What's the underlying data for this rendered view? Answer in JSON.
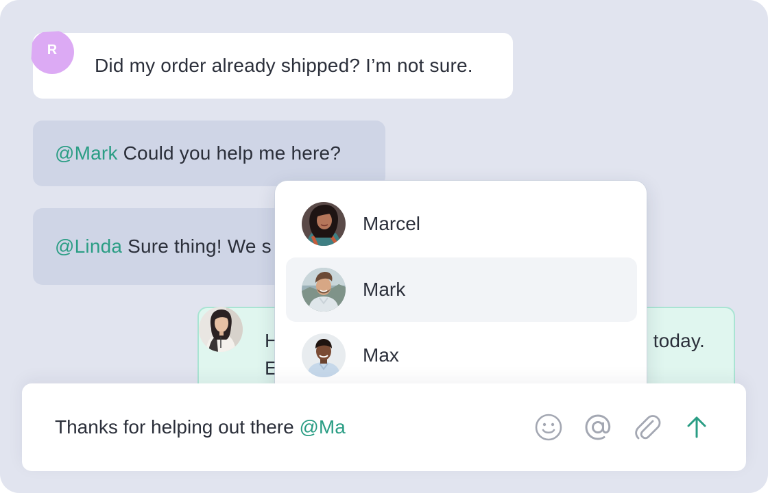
{
  "messages": {
    "customer": {
      "avatar_initial": "R",
      "text": "Did my order already shipped? I’m not sure."
    },
    "agent_reply_1": {
      "mention": "@Mark",
      "text": " Could you help me here?"
    },
    "agent_reply_2": {
      "mention": "@Linda",
      "text": " Sure thing! We s"
    },
    "linda_message": {
      "line1_start": "H",
      "line1_end": "today.",
      "line2_start": "E"
    }
  },
  "mention_dropdown": {
    "items": [
      {
        "name": "Marcel",
        "highlighted": false
      },
      {
        "name": "Mark",
        "highlighted": true
      },
      {
        "name": "Max",
        "highlighted": false
      }
    ]
  },
  "composer": {
    "text": "Thanks for helping out there ",
    "mention_partial": "@Ma",
    "icons": [
      "emoji-icon",
      "at-sign-icon",
      "paperclip-icon",
      "send-arrow-icon"
    ]
  },
  "colors": {
    "background": "#e1e4ef",
    "mention": "#2a9d84",
    "agent_bubble": "#cfd5e6",
    "linda_bubble": "#e0f6ef",
    "avatar_r": "#dcaaf4",
    "send": "#2a9d84"
  }
}
